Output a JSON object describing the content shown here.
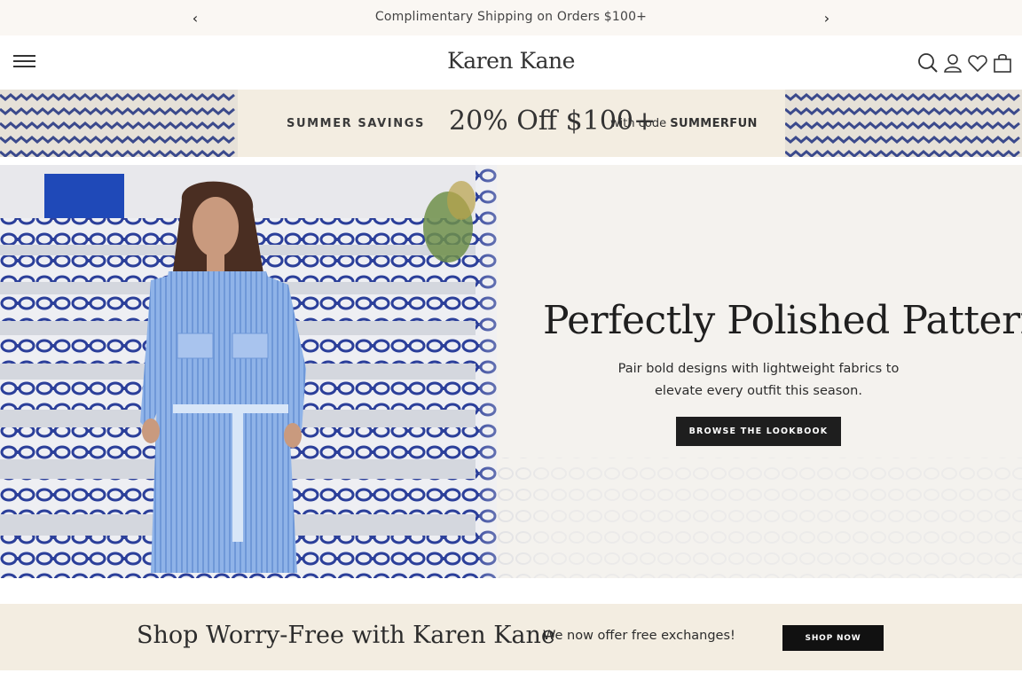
{
  "announcement": {
    "message": "Complimentary Shipping on Orders $100+",
    "prev_icon": "chevron-left-icon",
    "next_icon": "chevron-right-icon"
  },
  "header": {
    "logo": "Karen Kane",
    "icons": [
      "menu-icon",
      "search-icon",
      "account-icon",
      "wishlist-heart-icon",
      "shopping-bag-icon"
    ]
  },
  "promo": {
    "kicker": "SUMMER SAVINGS",
    "offer": "20% Off $100+",
    "code_prefix": "with code",
    "code": "SUMMERFUN"
  },
  "hero": {
    "headline": "Perfectly Polished Patterns",
    "subtext": "Pair bold designs with lightweight fabrics to elevate every outfit this season.",
    "cta": "BROWSE THE LOOKBOOK"
  },
  "worry_free": {
    "title": "Shop Worry-Free with Karen Kane",
    "text": "We now offer free exchanges!",
    "cta": "SHOP NOW"
  },
  "colors": {
    "announce_bg": "#faf7f3",
    "cream": "#f3ede1",
    "tile_blue": "#2b3f9a",
    "dark": "#1e1e1e"
  }
}
